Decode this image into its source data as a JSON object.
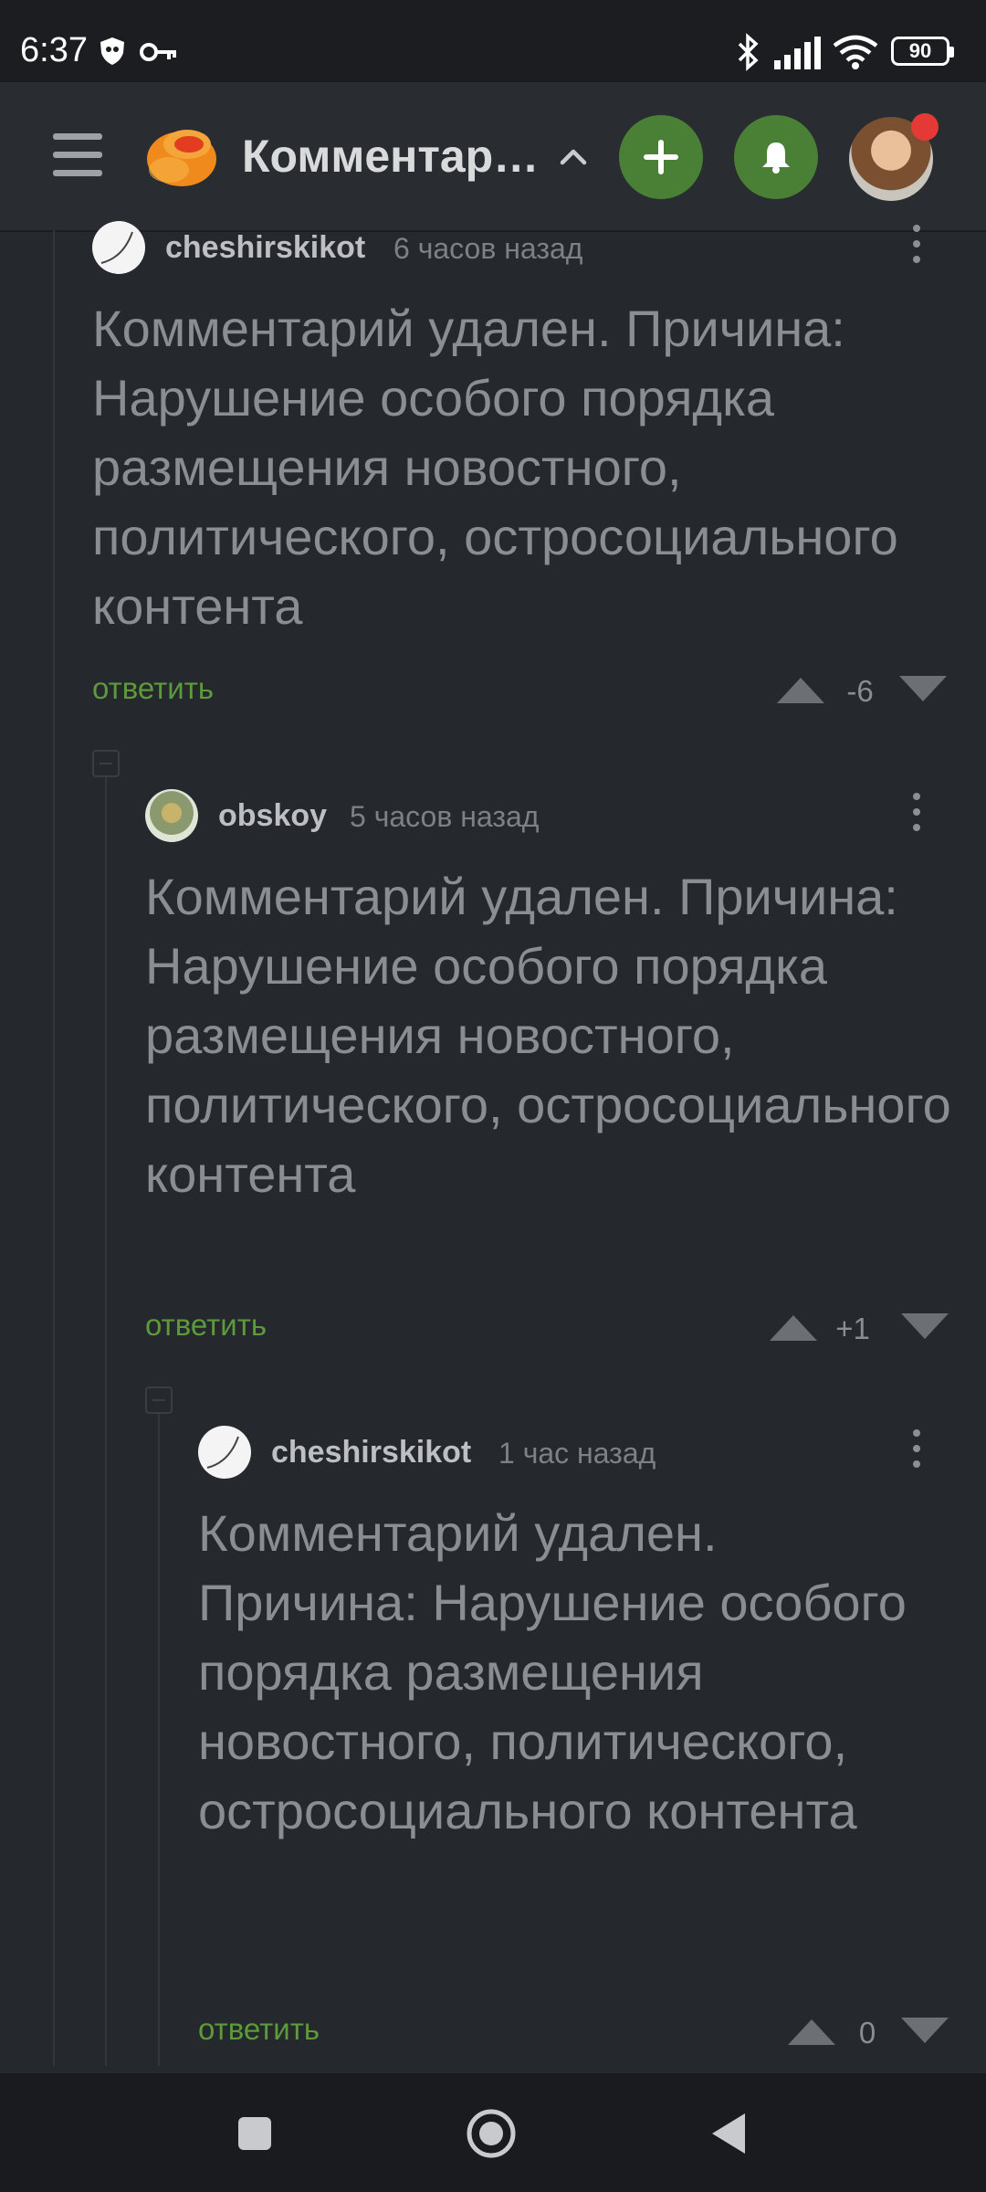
{
  "status_bar": {
    "time": "6:37",
    "battery": "90"
  },
  "header": {
    "title": "Комментар…"
  },
  "comments": [
    {
      "author": "cheshirskikot",
      "time": "6 часов назад",
      "body": "Комментарий удален. Причина: Нарушение особого порядка размещения новостного, политического, остросоциального контента",
      "reply_label": "ответить",
      "score": "-6"
    },
    {
      "author": "obskoy",
      "time": "5 часов назад",
      "body": "Комментарий удален. Причина: Нарушение особого порядка размещения новостного, политического, остросоциального контента",
      "reply_label": "ответить",
      "score": "+1"
    },
    {
      "author": "cheshirskikot",
      "time": "1 час назад",
      "body": "Комментарий удален. Причина: Нарушение особого порядка размещения новостного, политического, остросоциального контента",
      "reply_label": "ответить",
      "score": "0"
    }
  ],
  "colors": {
    "background": "#25282c",
    "accent_green": "#4a7f36",
    "reply_green": "#5c9a3c",
    "notification_red": "#e53935"
  },
  "icons": {
    "status": [
      "shield-icon",
      "key-icon",
      "bluetooth-icon",
      "signal-icon",
      "wifi-icon",
      "battery-icon"
    ],
    "header": [
      "menu-icon",
      "app-logo",
      "chevron-up-icon",
      "plus-icon",
      "bell-icon",
      "user-avatar"
    ],
    "nav": [
      "recents-square-icon",
      "home-circle-icon",
      "back-triangle-icon"
    ]
  }
}
